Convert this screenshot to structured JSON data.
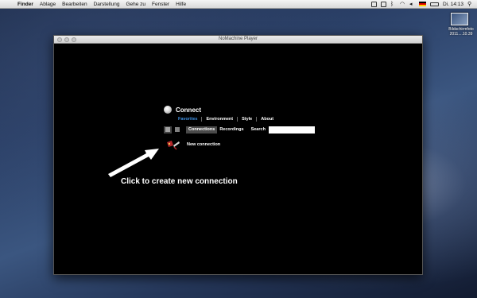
{
  "menubar": {
    "app_name": "Finder",
    "menus": [
      "Ablage",
      "Bearbeiten",
      "Darstellung",
      "Gehe zu",
      "Fenster",
      "Hilfe"
    ],
    "clock": "Di. 14:13"
  },
  "desktop": {
    "icon_label": "Bildschirmfoto 2011....10.39"
  },
  "window": {
    "title": "NoMachine Player"
  },
  "app": {
    "heading": "Connect",
    "subtabs": [
      "Favorites",
      "Environment",
      "Style",
      "About"
    ],
    "tabs": [
      "Connections",
      "Recordings"
    ],
    "search_label": "Search",
    "search_value": "",
    "connection_label": "New connection",
    "hint": "Click to create new connection"
  },
  "colors": {
    "accent": "#3f8fe0",
    "window_bg": "#000000"
  }
}
